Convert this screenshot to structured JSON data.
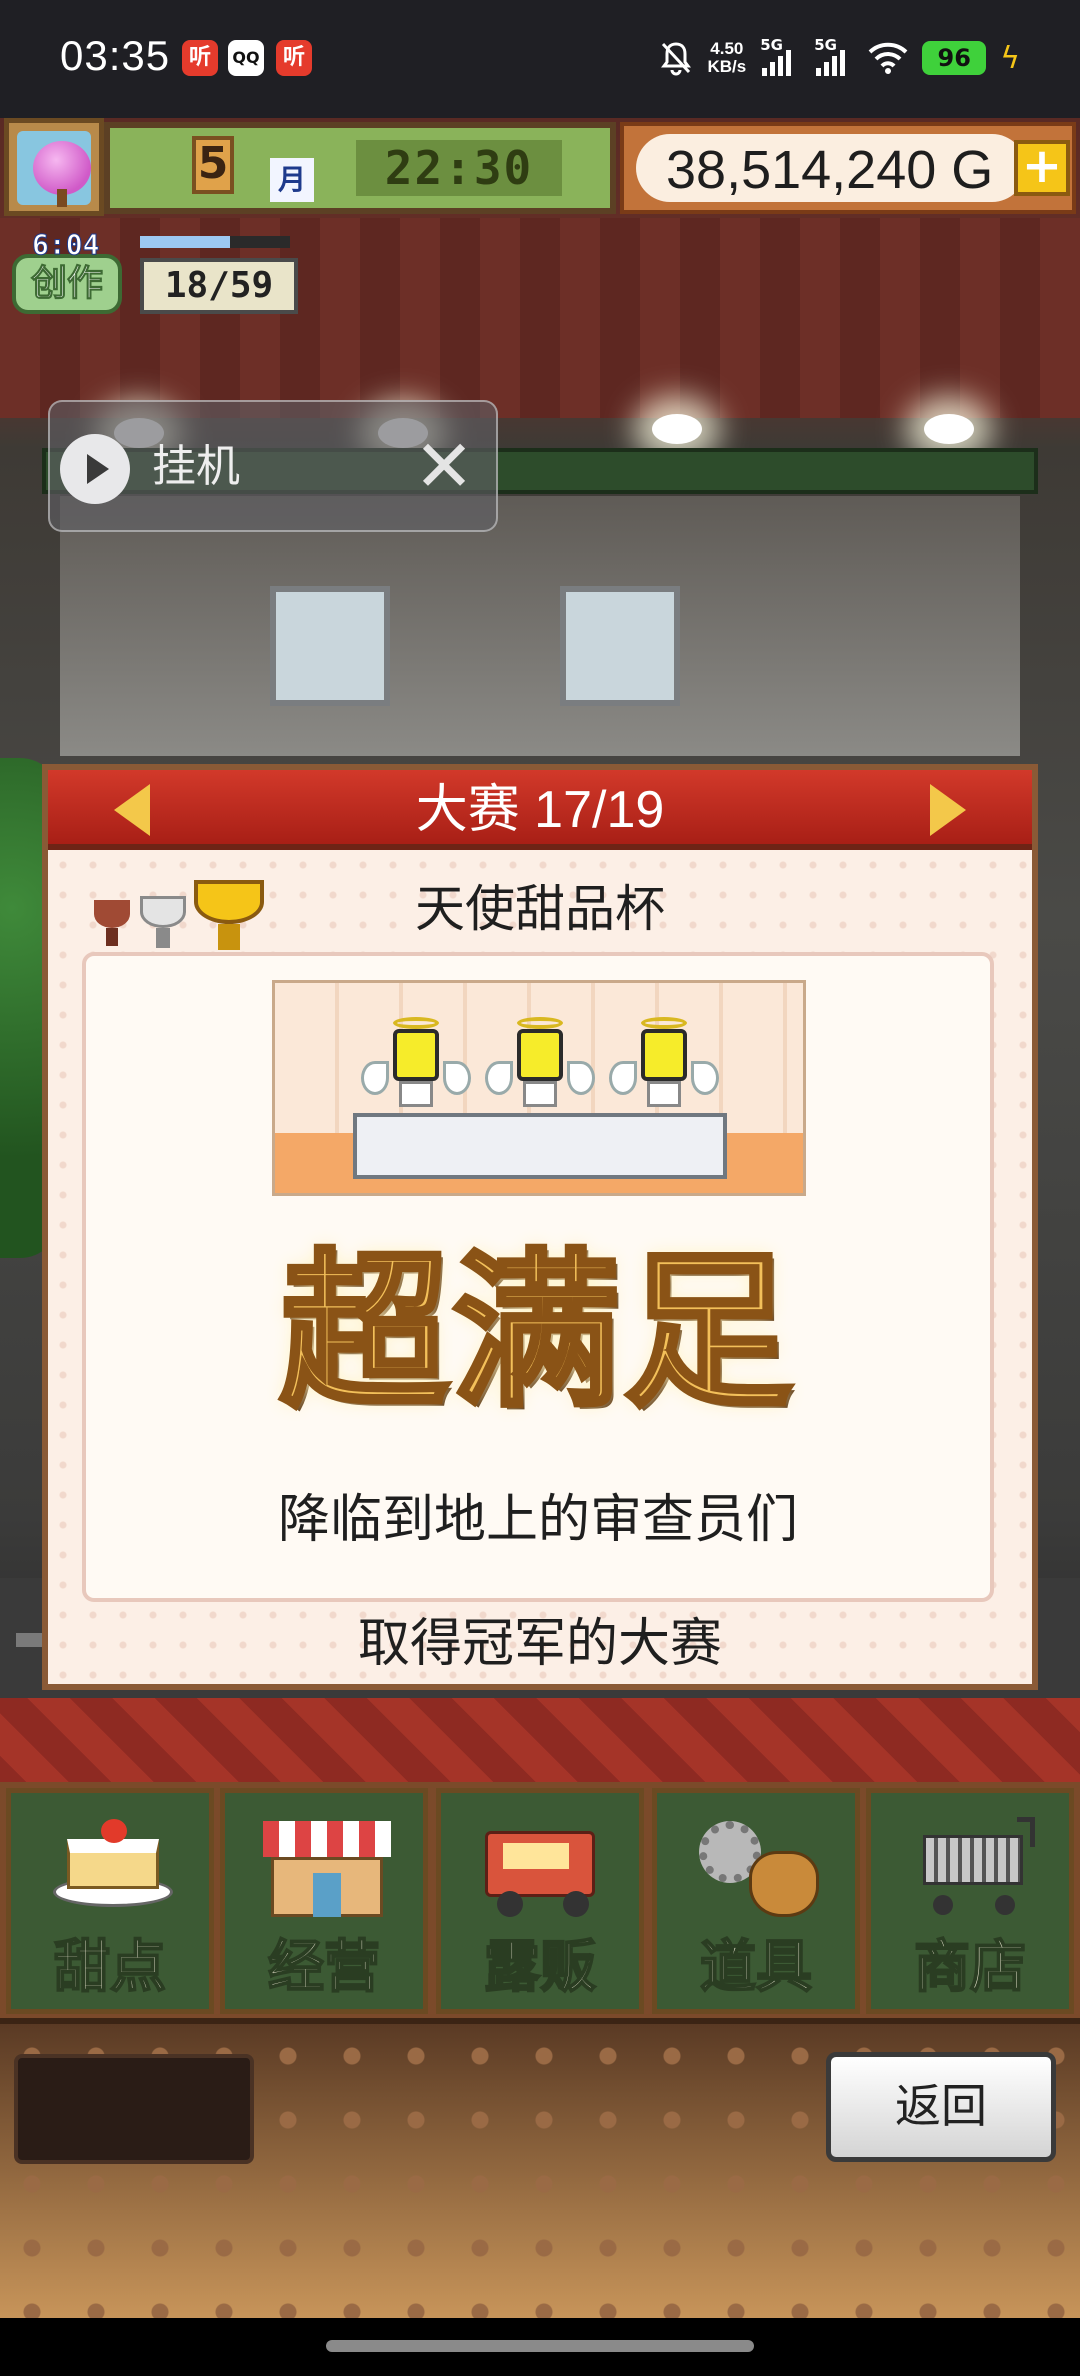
{
  "status_bar": {
    "time": "03:35",
    "notification_icons": [
      "听",
      "QQ",
      "听"
    ],
    "net_speed_value": "4.50",
    "net_speed_unit": "KB/s",
    "signal_1": "5G",
    "signal_2": "5G",
    "battery": "96"
  },
  "hud": {
    "month": "5",
    "month_label": "月",
    "clock": "22:30",
    "gold": "38,514,240 G",
    "gold_add": "+",
    "creation_label": "创作",
    "creation_timer": "6:04",
    "creation_progress": 0.6,
    "creation_count": "18/59"
  },
  "floating_bubble": {
    "label": "挂机",
    "close": "✕"
  },
  "contest_panel": {
    "title": "大赛 17/19",
    "cup_name": "天使甜品杯",
    "result": "超满足",
    "subtitle": "降临到地上的审查员们",
    "footer": "取得冠军的大赛",
    "trophies": [
      "bronze-trophy-icon",
      "silver-trophy-icon",
      "gold-trophy-icon"
    ]
  },
  "menu": {
    "items": [
      {
        "label": "甜点",
        "icon": "cake-icon"
      },
      {
        "label": "经营",
        "icon": "shop-icon"
      },
      {
        "label": "露贩",
        "icon": "food-truck-icon"
      },
      {
        "label": "道具",
        "icon": "gear-bag-icon"
      },
      {
        "label": "商店",
        "icon": "shopping-cart-icon"
      }
    ]
  },
  "back_button": "返回",
  "colors": {
    "panel_header": "#c22d20",
    "accent_gold": "#f5c518",
    "menu_green": "#3c5a34"
  }
}
